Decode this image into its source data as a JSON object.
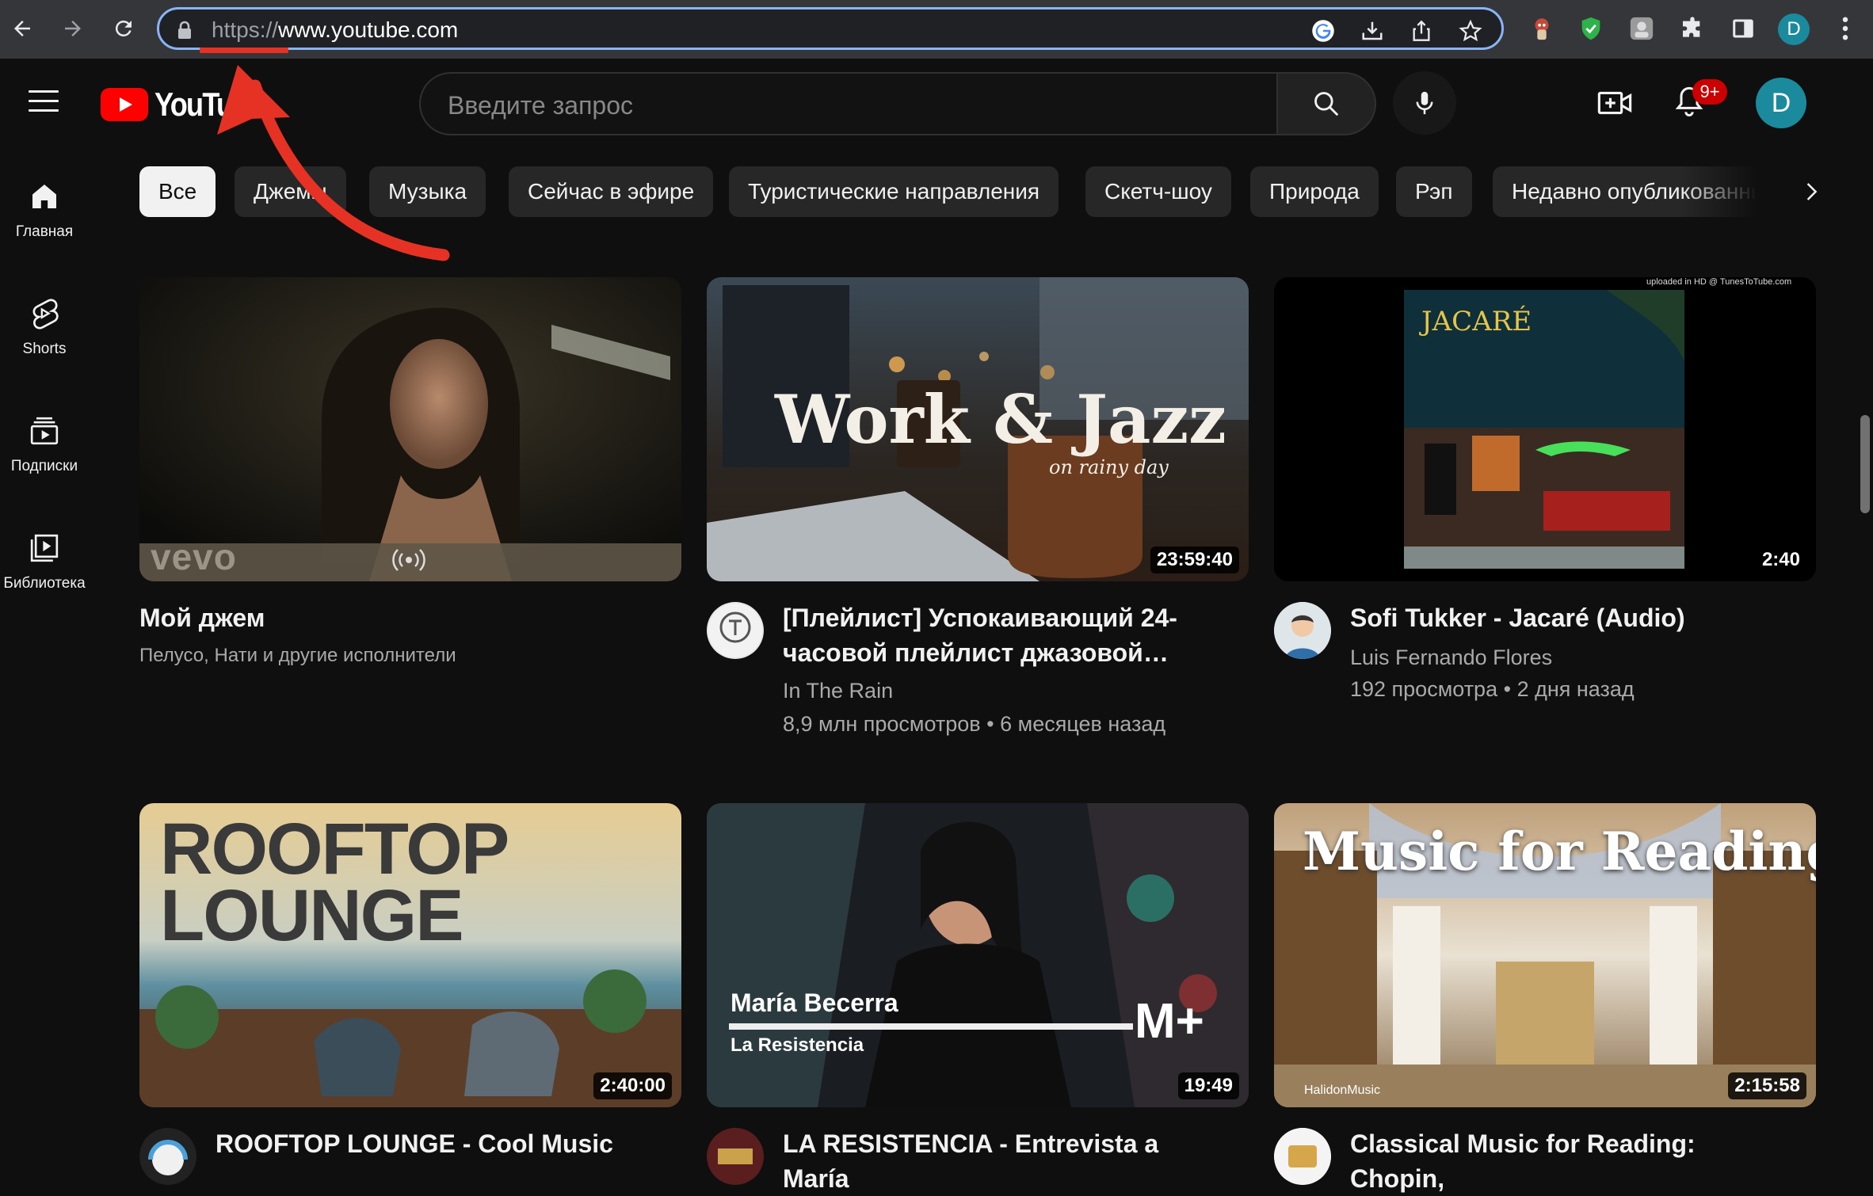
{
  "browser": {
    "url_scheme": "https://",
    "url_host": "www.youtube.com",
    "profile_initial": "D",
    "accent": "#8ab4f8",
    "extensions": [
      "adblock-icon",
      "shield-extension-icon",
      "extension-gray-icon",
      "puzzle-extensions-icon",
      "side-panel-icon"
    ]
  },
  "header": {
    "logo_text": "YouTube",
    "search_placeholder": "Введите запрос",
    "notifications_badge": "9+",
    "avatar_initial": "D",
    "brand_red": "#ff0000"
  },
  "sidebar": {
    "items": [
      {
        "label": "Главная",
        "icon": "home-icon"
      },
      {
        "label": "Shorts",
        "icon": "shorts-icon"
      },
      {
        "label": "Подписки",
        "icon": "subscriptions-icon"
      },
      {
        "label": "Библиотека",
        "icon": "library-icon"
      }
    ]
  },
  "chips": [
    "Все",
    "Джемы",
    "Музыка",
    "Сейчас в эфире",
    "Туристические направления",
    "Скетч-шоу",
    "Природа",
    "Рэп",
    "Недавно опубликованные"
  ],
  "videos": [
    {
      "title": "Мой джем",
      "channel": "Пелусо, Нати и другие исполнители",
      "views": "",
      "age": "",
      "duration": "",
      "thumb_watermark": "vevo"
    },
    {
      "title": "[Плейлист] Успокаивающий 24-часовой плейлист джазовой…",
      "channel": "In The Rain",
      "views": "8,9 млн просмотров",
      "age": "6 месяцев назад",
      "duration": "23:59:40",
      "thumb_text": "Work & Jazz",
      "thumb_subtext": "on rainy day"
    },
    {
      "title": "Sofi Tukker - Jacaré (Audio)",
      "channel": "Luis Fernando Flores",
      "views": "192 просмотра",
      "age": "2 дня назад",
      "duration": "2:40",
      "thumb_text": "JACARÉ",
      "thumb_subtext": "uploaded in HD @ TunesToTube.com"
    },
    {
      "title": "ROOFTOP LOUNGE - Cool Music",
      "duration": "2:40:00",
      "thumb_text_1": "ROOFTOP",
      "thumb_text_2": "LOUNGE"
    },
    {
      "title": "LA RESISTENCIA - Entrevista a María",
      "duration": "19:49",
      "thumb_text_1": "María Becerra",
      "thumb_text_2": "La Resistencia",
      "thumb_brand": "M+"
    },
    {
      "title": "Classical Music for Reading: Chopin,",
      "duration": "2:15:58",
      "thumb_text": "Music for Reading",
      "thumb_subtext": "HalidonMusic"
    }
  ],
  "annotation": {
    "arrow_color": "#e53224"
  }
}
